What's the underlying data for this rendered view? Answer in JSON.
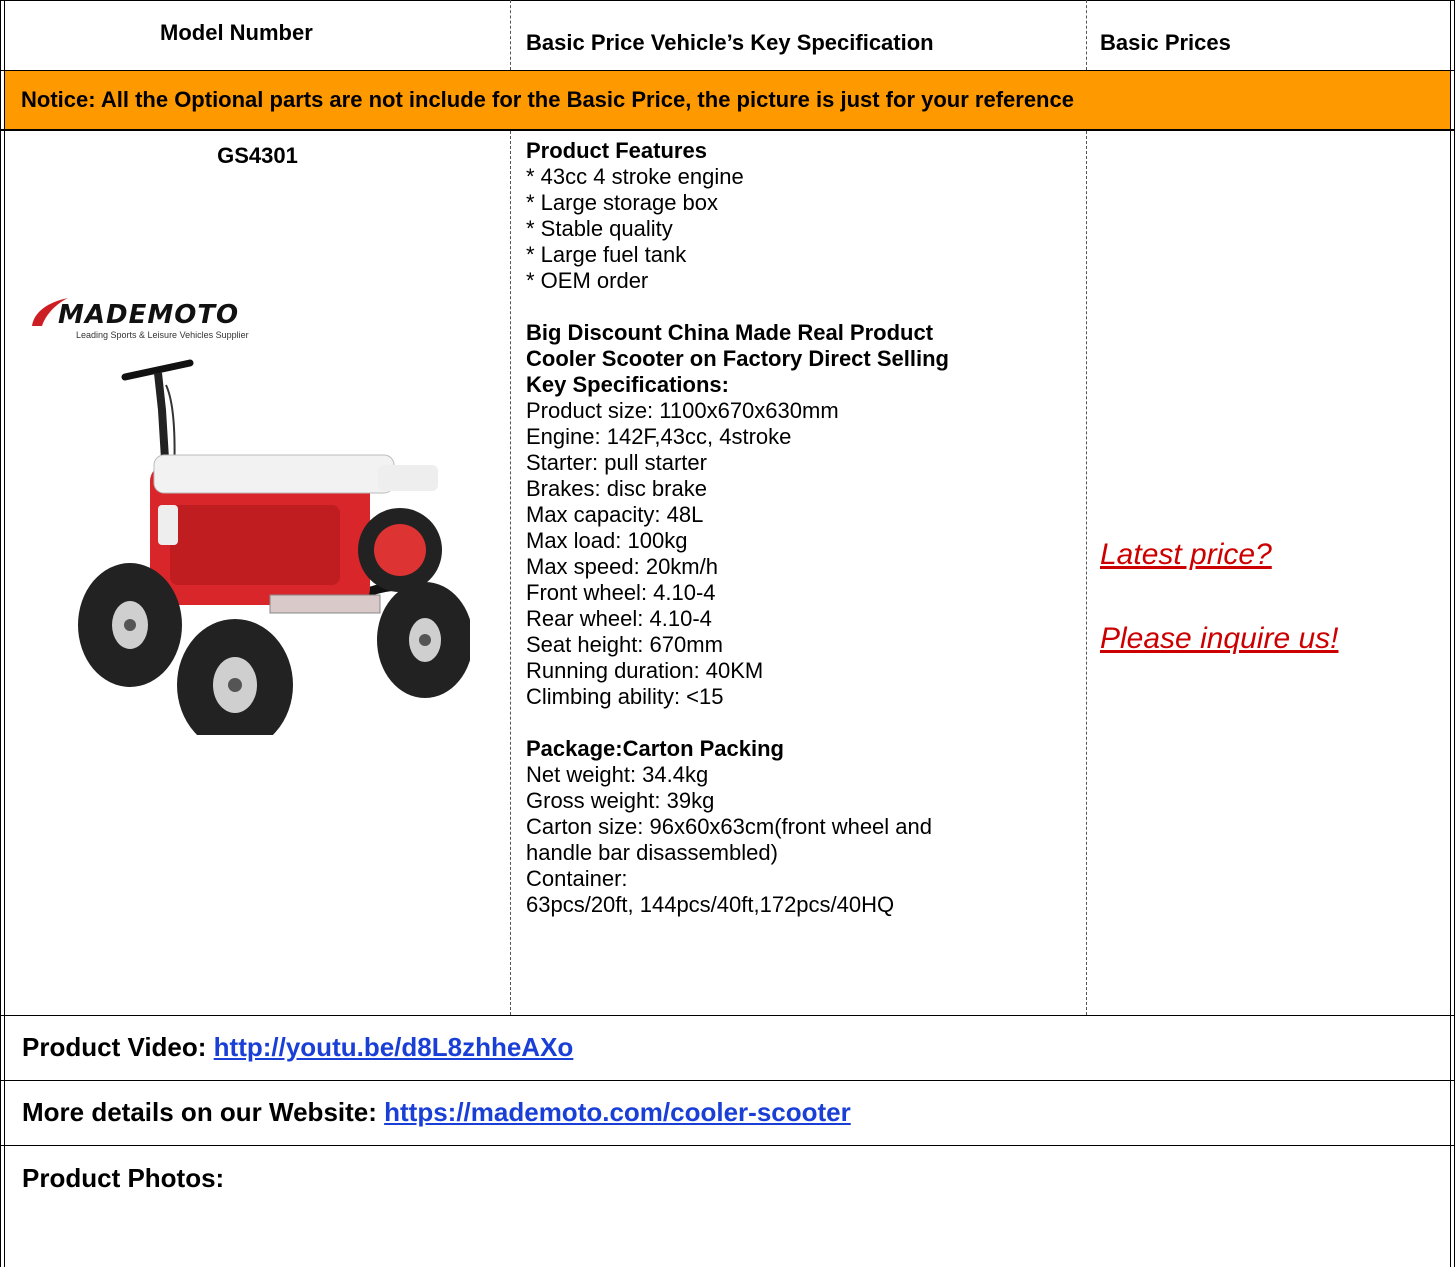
{
  "header": {
    "col1": "Model Number",
    "col2": "Basic Price Vehicle’s Key Specification",
    "col3": "Basic Prices"
  },
  "notice": "Notice: All the Optional parts are not include for the Basic Price, the picture is just for your reference",
  "product": {
    "model": "GS4301",
    "logo_text": "MADEMOTO",
    "logo_tagline": "Leading Sports & Leisure Vehicles Supplier",
    "features_title": "Product Features",
    "features": [
      "* 43cc 4 stroke engine",
      "* Large storage box",
      "* Stable quality",
      "* Large fuel tank",
      "* OEM order"
    ],
    "headline_lines": [
      "Big Discount China Made Real Product",
      "Cooler Scooter on Factory Direct Selling",
      "Key Specifications:"
    ],
    "specs": [
      "Product size: 1100x670x630mm",
      "Engine: 142F,43cc, 4stroke",
      "Starter: pull starter",
      "Brakes: disc brake",
      "Max capacity: 48L",
      "Max load: 100kg",
      "Max speed: 20km/h",
      "Front wheel: 4.10-4",
      "Rear wheel: 4.10-4",
      "Seat height: 670mm",
      "Running duration: 40KM",
      "Climbing ability: <15"
    ],
    "package_title": "Package:Carton Packing",
    "package": [
      "Net weight: 34.4kg",
      "Gross weight: 39kg",
      "Carton size: 96x60x63cm(front wheel and",
      "handle bar disassembled)",
      "Container:",
      "63pcs/20ft, 144pcs/40ft,172pcs/40HQ"
    ],
    "price_link1": "Latest price? ",
    "price_link2": "Please inquire us!"
  },
  "video": {
    "label": "Product Video: ",
    "link": "http://youtu.be/d8L8zhheAXo"
  },
  "website": {
    "label": "More details on our Website: ",
    "link": "https://mademoto.com/cooler-scooter"
  },
  "photos": {
    "label": "Product Photos:"
  },
  "colors": {
    "notice_bg": "#ff9900",
    "price_link": "#cc0000",
    "url_link": "#1a3fd6",
    "cooler_red": "#d8262a"
  }
}
